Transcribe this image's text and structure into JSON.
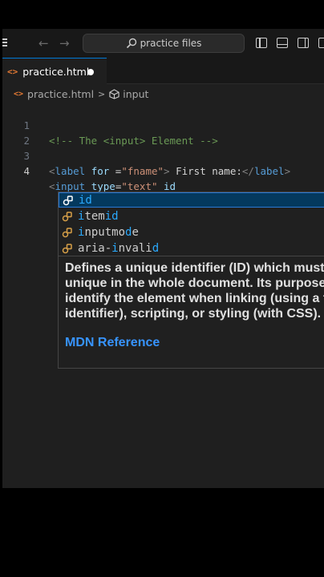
{
  "titlebar": {
    "back_arrow": "←",
    "forward_arrow": "→",
    "search_text": "practice files"
  },
  "tab": {
    "icon_text": "<>",
    "label": "practice.html"
  },
  "breadcrumb": {
    "icon_text": "<>",
    "file": "practice.html",
    "separator": ">",
    "element": "input"
  },
  "editor": {
    "lines": [
      {
        "num": "1"
      },
      {
        "num": "2"
      },
      {
        "num": "3"
      },
      {
        "num": "4"
      }
    ],
    "line1": {
      "comment": "<!-- The <input> Element -->"
    },
    "line3": {
      "open_bracket": "<",
      "tag": "label",
      "attr": "for",
      "eq": " =",
      "value": "\"fname\"",
      "close_bracket": ">",
      "text": " First name:",
      "end_open": "</",
      "end_tag": "label",
      "end_close": ">"
    },
    "line4": {
      "open_bracket": "<",
      "tag": "input",
      "attr": "type",
      "eq": "=",
      "value": "\"text\"",
      "partial": "id"
    }
  },
  "suggestions": [
    {
      "match": "id",
      "rest": "",
      "pre": ""
    },
    {
      "pre": "",
      "match": "i",
      "mid": "tem",
      "match2": "id",
      "rest": ""
    },
    {
      "pre": "",
      "match": "i",
      "mid": "nputmo",
      "match2": "d",
      "rest": "e"
    },
    {
      "pre": "aria-",
      "match": "i",
      "mid": "nvali",
      "match2": "d",
      "rest": ""
    }
  ],
  "docs": {
    "description": "Defines a unique identifier (ID) which must be unique in the whole document. Its purpose is to identify the element when linking (using a fragment identifier), scripting, or styling (with CSS).",
    "link": "MDN Reference"
  },
  "colors": {
    "accent": "#0078d4",
    "match_highlight": "#2aaaff",
    "selected_row": "#04395e",
    "link": "#3794ff",
    "modified_icon": "#e37933"
  }
}
